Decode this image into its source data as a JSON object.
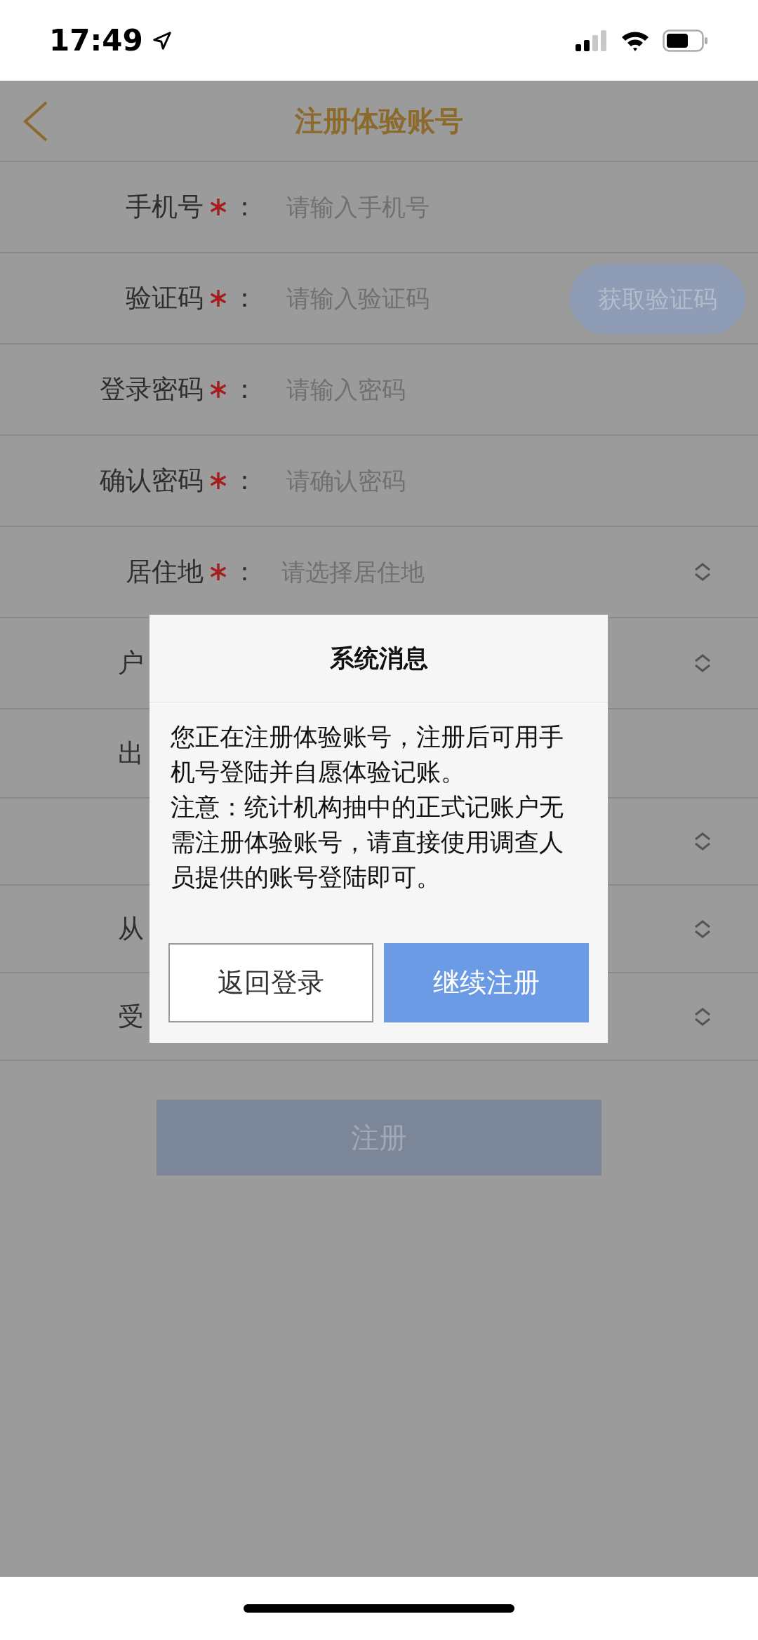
{
  "status_bar": {
    "time": "17:49"
  },
  "nav": {
    "title": "注册体验账号"
  },
  "form": {
    "fields": [
      {
        "kind": "input",
        "label": "手机号",
        "required": true,
        "colon": "：",
        "placeholder": "请输入手机号"
      },
      {
        "kind": "input",
        "label": "验证码",
        "required": true,
        "colon": "：",
        "placeholder": "请输入验证码",
        "action": "获取验证码"
      },
      {
        "kind": "input",
        "label": "登录密码",
        "required": true,
        "colon": "：",
        "placeholder": "请输入密码"
      },
      {
        "kind": "input",
        "label": "确认密码",
        "required": true,
        "colon": "：",
        "placeholder": "请确认密码"
      },
      {
        "kind": "select",
        "label": "居住地",
        "required": true,
        "colon": "：",
        "placeholder": "请选择居住地"
      },
      {
        "kind": "select",
        "label": "户"
      },
      {
        "kind": "plain",
        "label": "出"
      },
      {
        "kind": "select"
      },
      {
        "kind": "select",
        "label": "从"
      },
      {
        "kind": "select",
        "label": "受"
      }
    ]
  },
  "submit": {
    "label": "注册",
    "disabled": true
  },
  "dialog": {
    "title": "系统消息",
    "paragraphs": [
      "您正在注册体验账号，注册后可用手机号登陆并自愿体验记账。",
      "注意：统计机构抽中的正式记账户无需注册体验账号，请直接使用调查人员提供的账号登陆即可。"
    ],
    "buttons": [
      {
        "kind": "secondary",
        "label": "返回登录"
      },
      {
        "kind": "primary",
        "label": "继续注册"
      }
    ]
  }
}
